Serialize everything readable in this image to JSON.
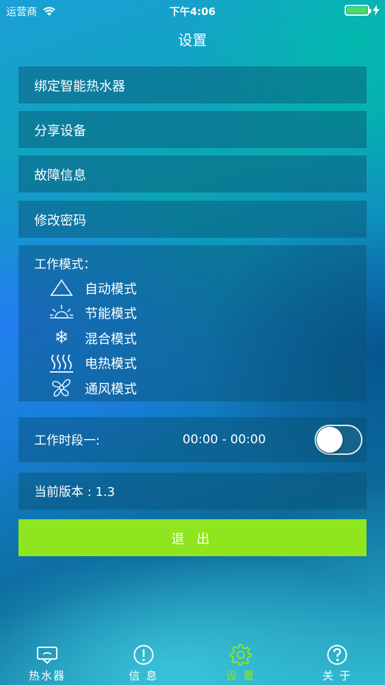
{
  "status_bar": {
    "carrier": "运营商",
    "time": "下午4:06"
  },
  "header": {
    "title": "设置"
  },
  "menu": {
    "bind_heater": "绑定智能热水器",
    "share_device": "分享设备",
    "fault_info": "故障信息",
    "change_password": "修改密码"
  },
  "work_modes": {
    "title": "工作模式：",
    "items": [
      {
        "label": "自动模式",
        "icon": "triangle-icon"
      },
      {
        "label": "节能模式",
        "icon": "sun-icon"
      },
      {
        "label": "混合模式",
        "icon": "snowflake-icon"
      },
      {
        "label": "电热模式",
        "icon": "heat-waves-icon"
      },
      {
        "label": "通风模式",
        "icon": "fan-icon"
      }
    ]
  },
  "work_period": {
    "label": "工作时段一:",
    "time_range": "00:00 - 00:00",
    "enabled": false
  },
  "version": {
    "label": "当前版本 : 1.3"
  },
  "logout_label": "退 出",
  "colors": {
    "accent": "#8fe61f",
    "row_bg": "rgba(8,80,110,0.45)"
  },
  "tabs": [
    {
      "label": "热水器",
      "icon": "water-heater-icon",
      "active": false
    },
    {
      "label": "信 息",
      "icon": "info-icon",
      "active": false
    },
    {
      "label": "设 置",
      "icon": "gear-icon",
      "active": true
    },
    {
      "label": "关 于",
      "icon": "help-icon",
      "active": false
    }
  ]
}
